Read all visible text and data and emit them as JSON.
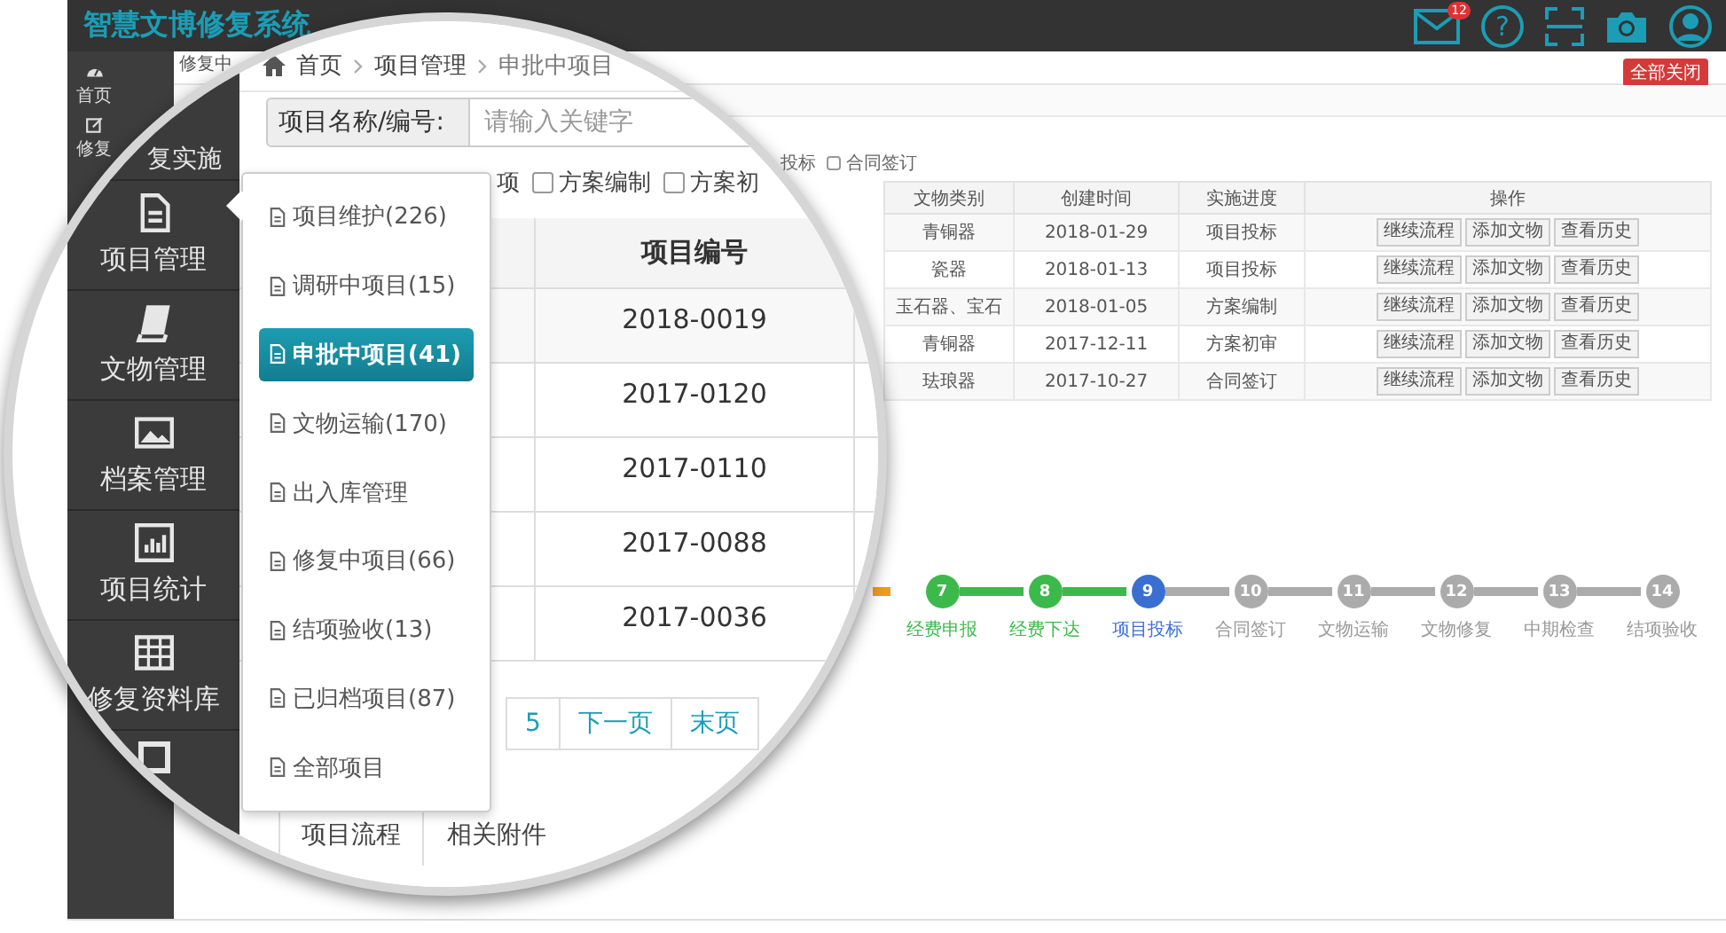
{
  "header": {
    "title": "智慧文博修复系统",
    "mail_badge": "12",
    "help": "?"
  },
  "sidebar": [
    {
      "label": "首页"
    },
    {
      "label": "修复"
    }
  ],
  "page_tab": "修复中",
  "close_all_button": "全部关闭",
  "filter_tail": {
    "text": "投标",
    "options": [
      {
        "label": "合同签订",
        "checked": false
      }
    ]
  },
  "table": {
    "columns": [
      "文物类别",
      "创建时间",
      "实施进度",
      "操作"
    ],
    "rows": [
      {
        "category": "青铜器",
        "created": "2018-01-29",
        "progress": "项目投标",
        "actions": [
          "继续流程",
          "添加文物",
          "查看历史"
        ]
      },
      {
        "category": "瓷器",
        "created": "2018-01-13",
        "progress": "项目投标",
        "actions": [
          "继续流程",
          "添加文物",
          "查看历史"
        ]
      },
      {
        "category": "玉石器、宝石",
        "created": "2018-01-05",
        "progress": "方案编制",
        "actions": [
          "继续流程",
          "添加文物",
          "查看历史"
        ]
      },
      {
        "category": "青铜器",
        "created": "2017-12-11",
        "progress": "方案初审",
        "actions": [
          "继续流程",
          "添加文物",
          "查看历史"
        ]
      },
      {
        "category": "珐琅器",
        "created": "2017-10-27",
        "progress": "合同签订",
        "actions": [
          "继续流程",
          "添加文物",
          "查看历史"
        ]
      }
    ]
  },
  "steps": [
    {
      "number": "7",
      "label": "经费申报",
      "completed": true,
      "selected": false
    },
    {
      "number": "8",
      "label": "经费下达",
      "completed": true,
      "selected": false
    },
    {
      "number": "9",
      "label": "项目投标",
      "completed": false,
      "selected": true
    },
    {
      "number": "10",
      "label": "合同签订",
      "completed": false,
      "selected": false
    },
    {
      "number": "11",
      "label": "文物运输",
      "completed": false,
      "selected": false
    },
    {
      "number": "12",
      "label": "文物修复",
      "completed": false,
      "selected": false
    },
    {
      "number": "13",
      "label": "中期检查",
      "completed": false,
      "selected": false
    },
    {
      "number": "14",
      "label": "结项验收",
      "completed": false,
      "selected": false
    }
  ],
  "magnifier": {
    "sidebar": [
      {
        "label": "复实施"
      },
      {
        "label": "项目管理"
      },
      {
        "label": "文物管理"
      },
      {
        "label": "档案管理"
      },
      {
        "label": "项目统计"
      },
      {
        "label": "修复资料库"
      }
    ],
    "breadcrumb": [
      "首页",
      "项目管理",
      "申批中项目"
    ],
    "search": {
      "label": "项目名称/编号:",
      "placeholder": "请输入关键字"
    },
    "filter": {
      "partial_label": "项",
      "options": [
        {
          "label": "方案编制",
          "checked": false
        },
        {
          "label": "方案初",
          "checked": false
        }
      ]
    },
    "table": {
      "column": "项目编号",
      "values": [
        "2018-0019",
        "2017-0120",
        "2017-0110",
        "2017-0088",
        "2017-0036"
      ]
    },
    "pagination": [
      "5",
      "下一页",
      "末页"
    ],
    "tabs": [
      {
        "label": "项目流程",
        "selected": true
      },
      {
        "label": "相关附件",
        "selected": false
      }
    ],
    "menu": [
      {
        "label": "项目维护(226)",
        "selected": false
      },
      {
        "label": "调研中项目(15)",
        "selected": false
      },
      {
        "label": "申批中项目(41)",
        "selected": true
      },
      {
        "label": "文物运输(170)",
        "selected": false
      },
      {
        "label": "出入库管理",
        "selected": false
      },
      {
        "label": "修复中项目(66)",
        "selected": false
      },
      {
        "label": "结项验收(13)",
        "selected": false
      },
      {
        "label": "已归档项目(87)",
        "selected": false
      },
      {
        "label": "全部项目",
        "selected": false
      }
    ]
  }
}
